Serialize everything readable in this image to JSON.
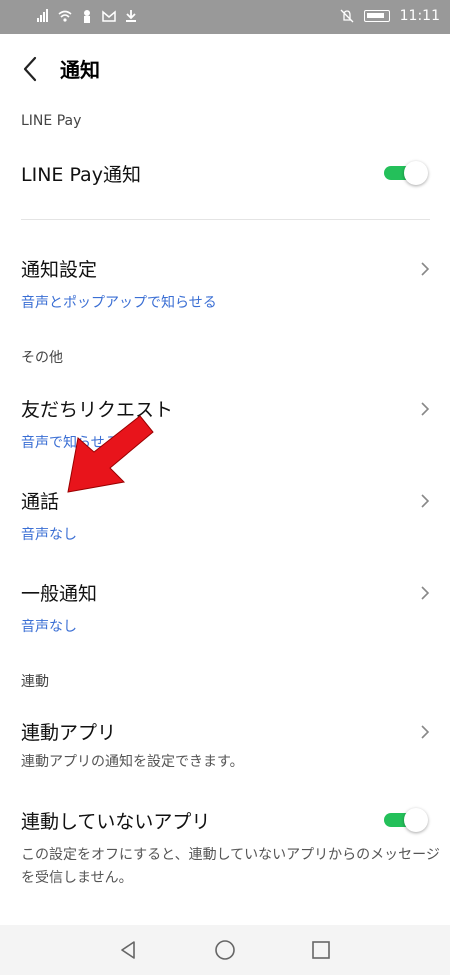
{
  "statusbar": {
    "left_icons": [
      "signal-icon",
      "wifi-icon",
      "line-notification-icon",
      "gmail-icon",
      "download-icon"
    ],
    "right_icons": [
      "mute-icon",
      "battery-icon"
    ],
    "time": "11:11"
  },
  "header": {
    "title": "通知",
    "back_icon": "chevron-left-icon"
  },
  "sections": {
    "linepay_label": "LINE Pay",
    "other_label": "その他",
    "linked_label": "連動"
  },
  "rows": {
    "linepay": {
      "title": "LINE Pay通知",
      "toggle_on": true
    },
    "settings": {
      "title": "通知設定",
      "sub": "音声とポップアップで知らせる"
    },
    "friend_request": {
      "title": "友だちリクエスト",
      "sub": "音声で知らせる"
    },
    "call": {
      "title": "通話",
      "sub": "音声なし"
    },
    "general": {
      "title": "一般通知",
      "sub": "音声なし"
    },
    "linked_apps": {
      "title": "連動アプリ",
      "sub": "連動アプリの通知を設定できます。"
    },
    "unlinked_apps": {
      "title": "連動していないアプリ",
      "sub": "この設定をオフにすると、連動していないアプリからのメッセージを受信しません。",
      "toggle_on": true
    }
  },
  "colors": {
    "accent_blue": "#3b6fd4",
    "toggle_green": "#24c05a",
    "statusbar_gray": "#999999",
    "annotation_red": "#e8141b"
  },
  "navbar": {
    "icons": [
      "back-triangle-icon",
      "home-circle-icon",
      "recents-square-icon"
    ]
  }
}
